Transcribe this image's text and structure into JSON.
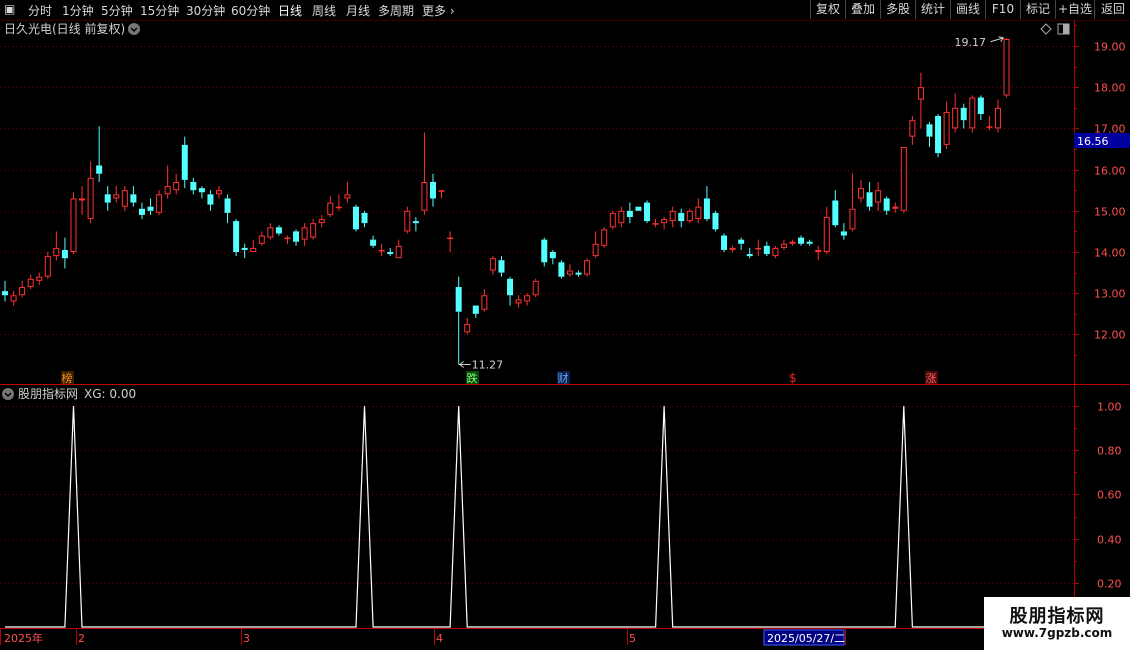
{
  "toolbar": {
    "periods": [
      "分时",
      "1分钟",
      "5分钟",
      "15分钟",
      "30分钟",
      "60分钟",
      "日线",
      "周线",
      "月线",
      "多周期",
      "更多"
    ],
    "active": "日线",
    "right_buttons": [
      "复权",
      "叠加",
      "多股",
      "统计",
      "画线",
      "F10",
      "标记",
      "+自选",
      "返回"
    ]
  },
  "main_chart": {
    "title": "日久光电(日线 前复权)",
    "current_price": "16.56",
    "price_axis": [
      "19.00",
      "18.00",
      "17.00",
      "16.00",
      "15.00",
      "14.00",
      "13.00",
      "12.00"
    ],
    "annotation_high": "19.17",
    "annotation_low": "11.27",
    "markers": [
      {
        "text": "榜",
        "color": "#ff8c1a"
      },
      {
        "text": "跌",
        "color": "#33cc33"
      },
      {
        "text": "财",
        "color": "#3399ff"
      },
      {
        "text": "$",
        "color": "#ff2020"
      },
      {
        "text": "涨",
        "color": "#ff2020"
      }
    ]
  },
  "indicator": {
    "title": "股朋指标网",
    "value_label": "XG: 0.00",
    "axis": [
      "1.00",
      "0.80",
      "0.60",
      "0.40",
      "0.20"
    ]
  },
  "time_axis": {
    "labels": [
      "2025年",
      "2",
      "3",
      "4",
      "5"
    ],
    "cursor_date": "2025/05/27/二"
  },
  "watermark": {
    "big": "股朋指标网",
    "small": "www.7gpzb.com"
  },
  "colors": {
    "up": "#ff3232",
    "down": "#54ffff",
    "grid": "#7a0000",
    "frame": "#b00000",
    "indicator_line": "#ffffff"
  },
  "chart_data": {
    "type": "candlestick",
    "title": "日久光电(日线 前复权)",
    "ylim": [
      11.0,
      19.6
    ],
    "candles": [
      [
        13.05,
        12.95,
        13.3,
        12.8
      ],
      [
        12.8,
        12.95,
        13.05,
        12.7
      ],
      [
        12.95,
        13.15,
        13.3,
        12.9
      ],
      [
        13.15,
        13.35,
        13.45,
        13.1
      ],
      [
        13.3,
        13.4,
        13.5,
        13.2
      ],
      [
        13.4,
        13.9,
        14.0,
        13.35
      ],
      [
        13.9,
        14.1,
        14.5,
        13.8
      ],
      [
        14.05,
        13.85,
        14.35,
        13.6
      ],
      [
        14.0,
        15.3,
        15.45,
        13.95
      ],
      [
        15.25,
        15.3,
        15.6,
        14.9
      ],
      [
        14.8,
        15.8,
        16.2,
        14.7
      ],
      [
        16.1,
        15.9,
        17.05,
        15.7
      ],
      [
        15.4,
        15.2,
        15.6,
        15.0
      ],
      [
        15.3,
        15.4,
        15.6,
        15.2
      ],
      [
        15.1,
        15.5,
        15.6,
        15.0
      ],
      [
        15.4,
        15.2,
        15.6,
        15.1
      ],
      [
        15.05,
        14.9,
        15.2,
        14.8
      ],
      [
        15.1,
        15.0,
        15.3,
        14.9
      ],
      [
        14.95,
        15.4,
        15.5,
        14.9
      ],
      [
        15.4,
        15.6,
        16.1,
        15.3
      ],
      [
        15.5,
        15.7,
        15.9,
        15.4
      ],
      [
        16.6,
        15.75,
        16.8,
        15.55
      ],
      [
        15.7,
        15.5,
        15.8,
        15.4
      ],
      [
        15.55,
        15.45,
        15.6,
        15.3
      ],
      [
        15.4,
        15.15,
        15.5,
        15.0
      ],
      [
        15.4,
        15.5,
        15.6,
        15.3
      ],
      [
        15.3,
        14.95,
        15.4,
        14.7
      ],
      [
        14.75,
        14.0,
        14.8,
        13.9
      ],
      [
        14.1,
        14.05,
        14.2,
        13.85
      ],
      [
        14.0,
        14.1,
        14.3,
        14.0
      ],
      [
        14.2,
        14.4,
        14.5,
        14.15
      ],
      [
        14.35,
        14.6,
        14.7,
        14.3
      ],
      [
        14.6,
        14.45,
        14.65,
        14.4
      ],
      [
        14.35,
        14.35,
        14.4,
        14.2
      ],
      [
        14.5,
        14.25,
        14.55,
        14.15
      ],
      [
        14.3,
        14.6,
        14.7,
        14.15
      ],
      [
        14.35,
        14.7,
        14.8,
        14.3
      ],
      [
        14.7,
        14.8,
        14.9,
        14.6
      ],
      [
        14.9,
        15.2,
        15.35,
        14.85
      ],
      [
        15.1,
        15.1,
        15.4,
        15.0
      ],
      [
        15.3,
        15.4,
        15.7,
        15.2
      ],
      [
        15.1,
        14.55,
        15.15,
        14.5
      ],
      [
        14.95,
        14.7,
        15.0,
        14.6
      ],
      [
        14.3,
        14.15,
        14.4,
        14.1
      ],
      [
        14.05,
        14.05,
        14.2,
        13.9
      ],
      [
        14.0,
        13.95,
        14.1,
        13.9
      ],
      [
        13.85,
        14.15,
        14.3,
        13.85
      ],
      [
        14.5,
        15.0,
        15.1,
        14.45
      ],
      [
        14.75,
        14.7,
        14.85,
        14.5
      ],
      [
        15.0,
        15.7,
        16.9,
        14.9
      ],
      [
        15.7,
        15.3,
        15.9,
        15.1
      ],
      [
        15.5,
        15.5,
        15.5,
        15.3
      ],
      [
        14.35,
        14.35,
        14.5,
        14.0
      ],
      [
        13.15,
        12.55,
        13.4,
        11.27
      ],
      [
        12.05,
        12.25,
        12.4,
        12.0
      ],
      [
        12.7,
        12.5,
        12.7,
        12.4
      ],
      [
        12.6,
        12.95,
        13.1,
        12.55
      ],
      [
        13.55,
        13.85,
        13.9,
        13.45
      ],
      [
        13.8,
        13.5,
        13.9,
        13.4
      ],
      [
        13.35,
        12.95,
        13.4,
        12.7
      ],
      [
        12.75,
        12.85,
        12.95,
        12.65
      ],
      [
        12.8,
        12.95,
        13.0,
        12.7
      ],
      [
        12.95,
        13.3,
        13.35,
        12.9
      ],
      [
        14.3,
        13.75,
        14.35,
        13.65
      ],
      [
        14.0,
        13.85,
        14.05,
        13.7
      ],
      [
        13.75,
        13.4,
        13.8,
        13.35
      ],
      [
        13.45,
        13.55,
        13.7,
        13.4
      ],
      [
        13.5,
        13.45,
        13.55,
        13.4
      ],
      [
        13.45,
        13.8,
        13.85,
        13.4
      ],
      [
        13.9,
        14.2,
        14.5,
        13.85
      ],
      [
        14.15,
        14.55,
        14.6,
        14.1
      ],
      [
        14.6,
        14.95,
        15.0,
        14.55
      ],
      [
        14.7,
        15.0,
        15.1,
        14.6
      ],
      [
        15.0,
        14.85,
        15.2,
        14.7
      ],
      [
        15.1,
        15.0,
        15.1,
        15.0
      ],
      [
        15.2,
        14.75,
        15.25,
        14.7
      ],
      [
        14.7,
        14.7,
        14.8,
        14.6
      ],
      [
        14.7,
        14.8,
        14.85,
        14.55
      ],
      [
        14.75,
        15.0,
        15.1,
        14.6
      ],
      [
        14.95,
        14.75,
        15.05,
        14.6
      ],
      [
        14.75,
        15.0,
        15.05,
        14.7
      ],
      [
        14.8,
        15.1,
        15.3,
        14.7
      ],
      [
        15.3,
        14.8,
        15.6,
        14.75
      ],
      [
        14.95,
        14.55,
        15.0,
        14.5
      ],
      [
        14.4,
        14.05,
        14.45,
        14.0
      ],
      [
        14.05,
        14.1,
        14.15,
        14.0
      ],
      [
        14.3,
        14.2,
        14.35,
        14.05
      ],
      [
        13.95,
        13.9,
        14.1,
        13.85
      ],
      [
        14.1,
        14.1,
        14.3,
        13.9
      ],
      [
        14.15,
        13.95,
        14.25,
        13.9
      ],
      [
        13.9,
        14.1,
        14.15,
        13.85
      ],
      [
        14.1,
        14.2,
        14.3,
        14.05
      ],
      [
        14.2,
        14.25,
        14.3,
        14.15
      ],
      [
        14.35,
        14.2,
        14.4,
        14.15
      ],
      [
        14.25,
        14.2,
        14.3,
        14.15
      ],
      [
        14.0,
        14.05,
        14.15,
        13.8
      ],
      [
        14.0,
        14.85,
        15.1,
        13.95
      ],
      [
        15.25,
        14.65,
        15.5,
        14.6
      ],
      [
        14.5,
        14.4,
        14.7,
        14.3
      ],
      [
        14.55,
        15.05,
        15.9,
        14.5
      ],
      [
        15.3,
        15.55,
        15.75,
        15.2
      ],
      [
        15.45,
        15.1,
        15.7,
        15.0
      ],
      [
        15.2,
        15.5,
        15.7,
        15.0
      ],
      [
        15.3,
        15.0,
        15.35,
        14.9
      ],
      [
        15.05,
        15.1,
        15.2,
        14.95
      ],
      [
        15.0,
        16.55,
        16.55,
        14.95
      ],
      [
        16.8,
        17.2,
        17.3,
        16.6
      ],
      [
        17.7,
        18.0,
        18.35,
        17.0
      ],
      [
        17.1,
        16.8,
        17.15,
        16.55
      ],
      [
        17.3,
        16.4,
        17.35,
        16.3
      ],
      [
        16.6,
        17.4,
        17.65,
        16.5
      ],
      [
        17.0,
        17.5,
        17.85,
        16.9
      ],
      [
        17.5,
        17.2,
        17.6,
        17.0
      ],
      [
        17.0,
        17.75,
        17.8,
        16.9
      ],
      [
        17.75,
        17.35,
        17.8,
        17.2
      ],
      [
        17.05,
        17.05,
        17.3,
        16.95
      ],
      [
        17.0,
        17.5,
        17.7,
        16.9
      ],
      [
        17.8,
        19.17,
        19.2,
        17.75
      ]
    ],
    "indicator_spikes_at": [
      8,
      42,
      53,
      77,
      105
    ],
    "ind_ylim": [
      0,
      1.1
    ]
  }
}
